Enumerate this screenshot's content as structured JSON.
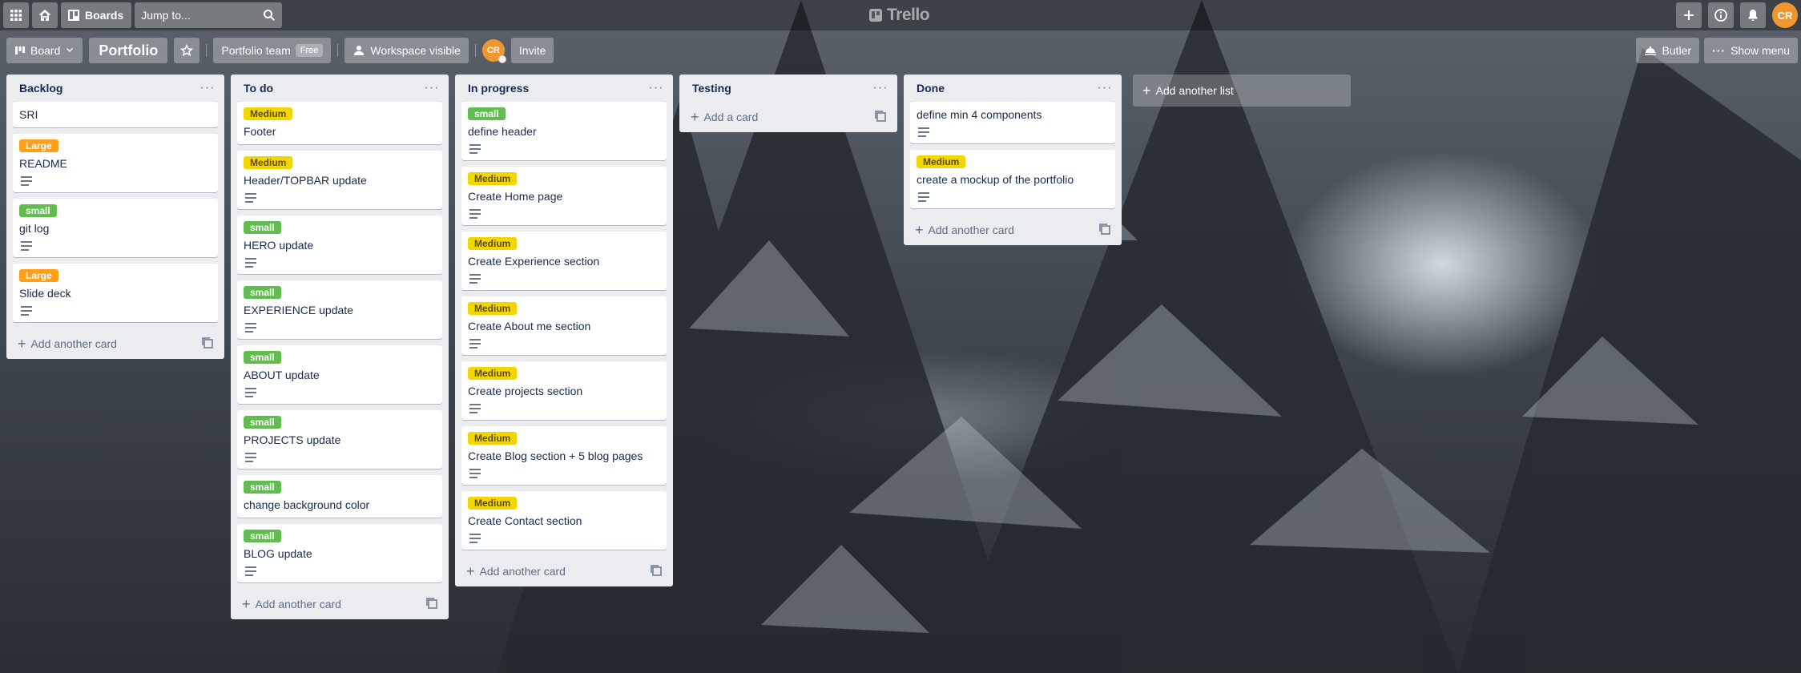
{
  "header": {
    "apps_icon": "grid-icon",
    "home_icon": "home-icon",
    "boards_label": "Boards",
    "search_placeholder": "Jump to...",
    "logo_text": "Trello",
    "user_initials": "CR"
  },
  "board_header": {
    "view_label": "Board",
    "title": "Portfolio",
    "team_label": "Portfolio team",
    "plan_badge": "Free",
    "visibility_label": "Workspace visible",
    "member_initials": "CR",
    "invite_label": "Invite",
    "butler_label": "Butler",
    "show_menu_label": "Show menu"
  },
  "lists": [
    {
      "title": "Backlog",
      "cards": [
        {
          "label": "",
          "title": "SRI",
          "has_description": false
        },
        {
          "label": "Large",
          "title": "README",
          "has_description": true
        },
        {
          "label": "small",
          "title": "git log",
          "has_description": true
        },
        {
          "label": "Large",
          "title": "Slide deck",
          "has_description": true
        }
      ],
      "footer": "Add another card"
    },
    {
      "title": "To do",
      "cards": [
        {
          "label": "Medium",
          "title": "Footer",
          "has_description": false
        },
        {
          "label": "Medium",
          "title": "Header/TOPBAR update",
          "has_description": true
        },
        {
          "label": "small",
          "title": "HERO update",
          "has_description": true
        },
        {
          "label": "small",
          "title": "EXPERIENCE update",
          "has_description": true
        },
        {
          "label": "small",
          "title": "ABOUT update",
          "has_description": true
        },
        {
          "label": "small",
          "title": "PROJECTS update",
          "has_description": true
        },
        {
          "label": "small",
          "title": "change background color",
          "has_description": false
        },
        {
          "label": "small",
          "title": "BLOG update",
          "has_description": true
        }
      ],
      "footer": "Add another card"
    },
    {
      "title": "In progress",
      "cards": [
        {
          "label": "small",
          "title": "define header",
          "has_description": true
        },
        {
          "label": "Medium",
          "title": "Create Home page",
          "has_description": true
        },
        {
          "label": "Medium",
          "title": "Create Experience section",
          "has_description": true
        },
        {
          "label": "Medium",
          "title": "Create About me section",
          "has_description": true
        },
        {
          "label": "Medium",
          "title": "Create projects section",
          "has_description": true
        },
        {
          "label": "Medium",
          "title": "Create Blog section + 5 blog pages",
          "has_description": true
        },
        {
          "label": "Medium",
          "title": "Create Contact section",
          "has_description": true
        }
      ],
      "footer": "Add another card"
    },
    {
      "title": "Testing",
      "cards": [],
      "footer": "Add a card"
    },
    {
      "title": "Done",
      "cards": [
        {
          "label": "",
          "title": "define min 4 components",
          "has_description": true
        },
        {
          "label": "Medium",
          "title": "create a mockup of the portfolio",
          "has_description": true
        }
      ],
      "footer": "Add another card"
    }
  ],
  "add_list_label": "Add another list",
  "colors": {
    "label_medium": "#f2d600",
    "label_large": "#ff9f1a",
    "label_small": "#61bd4f",
    "list_bg": "#ebecf0",
    "avatar": "#f0962e"
  }
}
